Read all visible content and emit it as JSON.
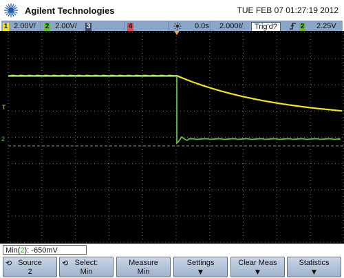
{
  "header": {
    "brand": "Agilent Technologies",
    "datetime": "TUE FEB 07 01:27:19 2012"
  },
  "status_bar": {
    "channels": [
      {
        "num": "1",
        "scale": "2.00V/",
        "color": "#f2e611"
      },
      {
        "num": "2",
        "scale": "2.00V/",
        "color": "#5fbf3a"
      },
      {
        "num": "3",
        "scale": "",
        "color": "#5aa0e0"
      },
      {
        "num": "4",
        "scale": "",
        "color": "#e84545"
      }
    ],
    "delay": "0.0s",
    "timebase": "2.000ℓ/",
    "trigger_status": "Trig'd?",
    "trigger_source": "2",
    "trigger_level": "2.25V"
  },
  "readout": {
    "prefix": "Min(",
    "channel": "2",
    "suffix": "): -650mV"
  },
  "softkeys": [
    {
      "line1": "Source",
      "line2": "2",
      "knob": true
    },
    {
      "line1": "Select:",
      "line2": "Min",
      "knob": true
    },
    {
      "line1": "Measure",
      "line2": "Min",
      "knob": false
    },
    {
      "line1": "Settings",
      "line2": "",
      "arrow": true
    },
    {
      "line1": "Clear Meas",
      "line2": "",
      "arrow": true
    },
    {
      "line1": "Statistics",
      "line2": "",
      "arrow": true
    }
  ],
  "colors": {
    "ch1": "#f2e611",
    "ch2": "#5fbf3a",
    "grid": "#7a7a7a",
    "screen_bg": "#000000"
  },
  "icons": {
    "brand_logo": "agilent-spark-icon",
    "trigger": "trigger-sun-icon",
    "knob": "rotary-knob-icon",
    "arrow": "down-arrow-icon"
  }
}
